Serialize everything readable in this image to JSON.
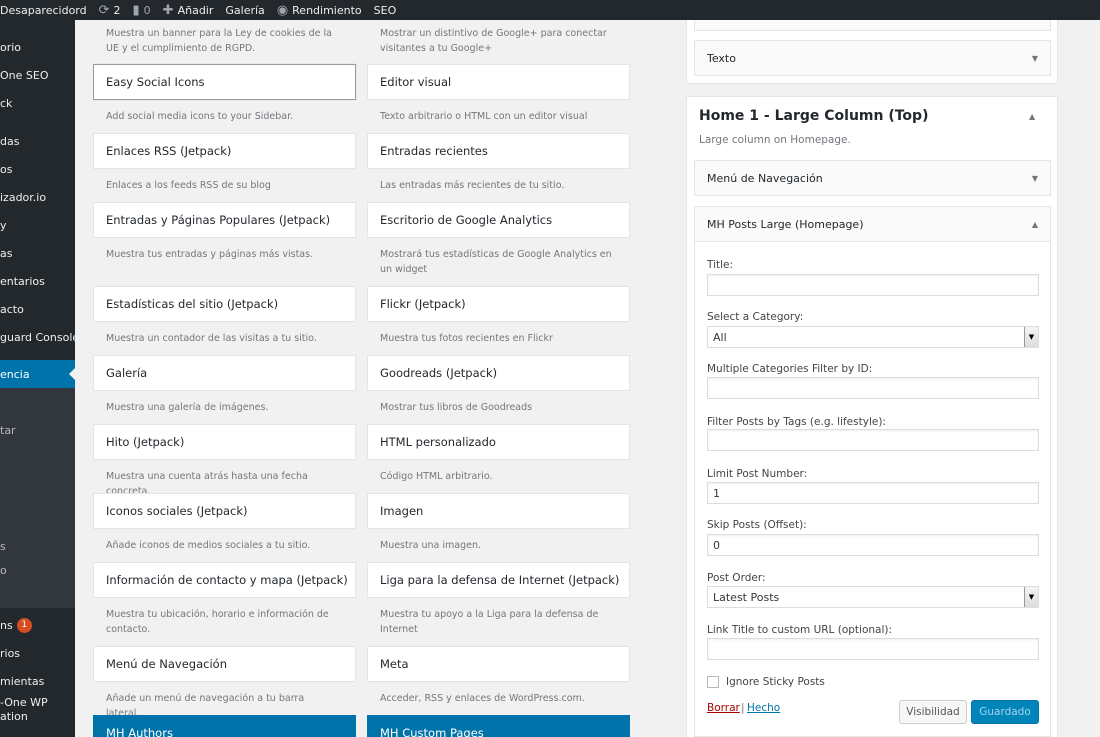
{
  "adminbar": {
    "site": "Desaparecidord",
    "updates": "2",
    "comments": "0",
    "new": "Añadir",
    "gallery": "Galería",
    "performance": "Rendimiento",
    "seo": "SEO"
  },
  "menu": {
    "items": [
      "orio",
      "One SEO",
      "ck",
      "das",
      "os",
      "izador.io",
      "y",
      "as",
      "entarios",
      "acto",
      "guard Console",
      "encia",
      "tar",
      "s",
      "o",
      "ns",
      "rios",
      "mientas",
      "-One WP\nation"
    ],
    "updates_badge": "1"
  },
  "widgets": [
    {
      "title": "",
      "desc": "Muestra un banner para la Ley de cookies de la UE y el cumplimiento de RGPD."
    },
    {
      "title": "",
      "desc": "Mostrar un distintivo de Google+ para conectar visitantes a tu Google+"
    },
    {
      "title": "Easy Social Icons",
      "desc": "Add social media icons to your Sidebar."
    },
    {
      "title": "Editor visual",
      "desc": "Texto arbitrario o HTML con un editor visual"
    },
    {
      "title": "Enlaces RSS (Jetpack)",
      "desc": "Enlaces a los feeds RSS de su blog"
    },
    {
      "title": "Entradas recientes",
      "desc": "Las entradas más recientes de tu sitio."
    },
    {
      "title": "Entradas y Páginas Populares (Jetpack)",
      "desc": "Muestra tus entradas y páginas más vistas."
    },
    {
      "title": "Escritorio de Google Analytics",
      "desc": "Mostrará tus estadísticas de Google Analytics en un widget"
    },
    {
      "title": "Estadísticas del sitio (Jetpack)",
      "desc": "Muestra un contador de las visitas a tu sitio."
    },
    {
      "title": "Flickr (Jetpack)",
      "desc": "Muestra tus fotos recientes en Flickr"
    },
    {
      "title": "Galería",
      "desc": "Muestra una galería de imágenes."
    },
    {
      "title": "Goodreads (Jetpack)",
      "desc": "Mostrar tus libros de Goodreads"
    },
    {
      "title": "Hito (Jetpack)",
      "desc": "Muestra una cuenta atrás hasta una fecha concreta."
    },
    {
      "title": "HTML personalizado",
      "desc": "Código HTML arbitrario."
    },
    {
      "title": "Iconos sociales (Jetpack)",
      "desc": "Añade iconos de medios sociales a tu sitio."
    },
    {
      "title": "Imagen",
      "desc": "Muestra una imagen."
    },
    {
      "title": "Información de contacto y mapa (Jetpack)",
      "desc": "Muestra tu ubicación, horario e información de contacto."
    },
    {
      "title": "Liga para la defensa de Internet (Jetpack)",
      "desc": "Muestra tu apoyo a la Liga para la defensa de Internet"
    },
    {
      "title": "Menú de Navegación",
      "desc": "Añade un menú de navegación a tu barra lateral."
    },
    {
      "title": "Meta",
      "desc": "Acceder, RSS y enlaces de WordPress.com."
    },
    {
      "title": "MH Authors",
      "desc": ""
    },
    {
      "title": "MH Custom Pages",
      "desc": ""
    }
  ],
  "sidebar_area": {
    "texto_widget": "Texto",
    "home_title": "Home 1 - Large Column (Top)",
    "home_desc": "Large column on Homepage.",
    "nav_widget": "Menú de Navegación",
    "posts_widget": "MH Posts Large (Homepage)"
  },
  "form": {
    "title_label": "Title:",
    "title_value": "",
    "category_label": "Select a Category:",
    "category_value": "All",
    "multi_label": "Multiple Categories Filter by ID:",
    "multi_value": "",
    "tags_label": "Filter Posts by Tags (e.g. lifestyle):",
    "tags_value": "",
    "limit_label": "Limit Post Number:",
    "limit_value": "1",
    "skip_label": "Skip Posts (Offset):",
    "skip_value": "0",
    "order_label": "Post Order:",
    "order_value": "Latest Posts",
    "link_label": "Link Title to custom URL (optional):",
    "link_value": "",
    "sticky_label": "Ignore Sticky Posts",
    "delete_link": "Borrar",
    "separator": "|",
    "done_link": "Hecho",
    "visibility_button": "Visibilidad",
    "save_button": "Guardado"
  },
  "colors": {
    "admin_dark": "#23282d",
    "accent_blue": "#0073aa",
    "primary_button": "#0085ba",
    "delete_red": "#a00",
    "link_blue": "#0073aa"
  }
}
